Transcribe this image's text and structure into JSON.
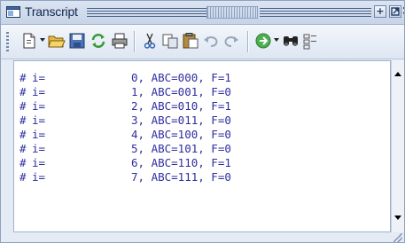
{
  "window": {
    "title": "Transcript"
  },
  "titlebar_buttons": [
    {
      "name": "dock-icon",
      "glyph": "+"
    },
    {
      "name": "undock-icon",
      "glyph": "↗"
    },
    {
      "name": "close-icon",
      "glyph": "×"
    }
  ],
  "toolbar": {
    "buttons": [
      "new-document-icon",
      "open-folder-icon",
      "save-icon",
      "refresh-icon",
      "print-icon",
      "cut-icon",
      "copy-icon",
      "paste-icon",
      "undo-icon",
      "redo-icon",
      "go-icon",
      "find-icon",
      "more-icon"
    ]
  },
  "transcript": {
    "lines": [
      {
        "hash": "#",
        "label": "i=",
        "index": "0",
        "abc": "000",
        "f": "1",
        "text": "0, ABC=000, F=1"
      },
      {
        "hash": "#",
        "label": "i=",
        "index": "1",
        "abc": "001",
        "f": "0",
        "text": "1, ABC=001, F=0"
      },
      {
        "hash": "#",
        "label": "i=",
        "index": "2",
        "abc": "010",
        "f": "1",
        "text": "2, ABC=010, F=1"
      },
      {
        "hash": "#",
        "label": "i=",
        "index": "3",
        "abc": "011",
        "f": "0",
        "text": "3, ABC=011, F=0"
      },
      {
        "hash": "#",
        "label": "i=",
        "index": "4",
        "abc": "100",
        "f": "0",
        "text": "4, ABC=100, F=0"
      },
      {
        "hash": "#",
        "label": "i=",
        "index": "5",
        "abc": "101",
        "f": "0",
        "text": "5, ABC=101, F=0"
      },
      {
        "hash": "#",
        "label": "i=",
        "index": "6",
        "abc": "110",
        "f": "1",
        "text": "6, ABC=110, F=1"
      },
      {
        "hash": "#",
        "label": "i=",
        "index": "7",
        "abc": "111",
        "f": "0",
        "text": "7, ABC=111, F=0"
      }
    ]
  },
  "colors": {
    "transcript_text": "#2f2ea0",
    "window_bg": "#e4ebf4",
    "titlebar_text": "#10284f"
  }
}
